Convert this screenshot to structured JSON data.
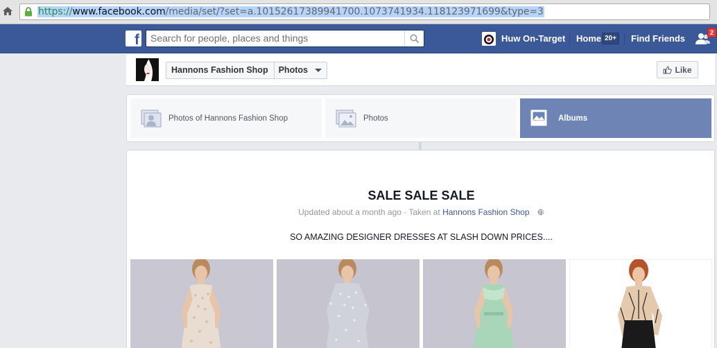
{
  "browser": {
    "url_scheme": "https://",
    "url_host": "www.facebook.com",
    "url_path": "/media/set/?set=a.10152617389941700.1073741934.118123971699&type=3"
  },
  "navbar": {
    "search_placeholder": "Search for people, places and things",
    "user_name": "Huw On-Target",
    "home_label": "Home",
    "home_count": "20+",
    "find_friends_label": "Find Friends",
    "friend_requests_count": "2"
  },
  "page": {
    "name": "Hannons Fashion Shop",
    "section": "Photos",
    "like_label": "Like"
  },
  "tabs": [
    {
      "label": "Photos of Hannons Fashion Shop",
      "active": false
    },
    {
      "label": "Photos",
      "active": false
    },
    {
      "label": "Albums",
      "active": true
    }
  ],
  "album": {
    "title": "SALE SALE SALE",
    "updated": "Updated about a month ago",
    "taken_at_prefix": "· Taken at",
    "place": "Hannons Fashion Shop",
    "description": "SO AMAZING DESIGNER DRESSES AT SLASH DOWN PRICES...."
  },
  "photos": [
    {
      "name": "dress-photo-1",
      "dress_color": "#e8ddd0",
      "bg": "#c9c7d2"
    },
    {
      "name": "dress-photo-2",
      "dress_color": "#cfd2da",
      "bg": "#c6c5cf"
    },
    {
      "name": "dress-photo-3",
      "dress_color": "#a9d6b8",
      "bg": "#c7c6d0"
    },
    {
      "name": "dress-photo-4",
      "dress_color": "#1a1a1a",
      "bg": "#ffffff"
    }
  ],
  "colors": {
    "fb_blue": "#3b5998",
    "active_tab": "#6d84b4",
    "link": "#3b5998"
  }
}
